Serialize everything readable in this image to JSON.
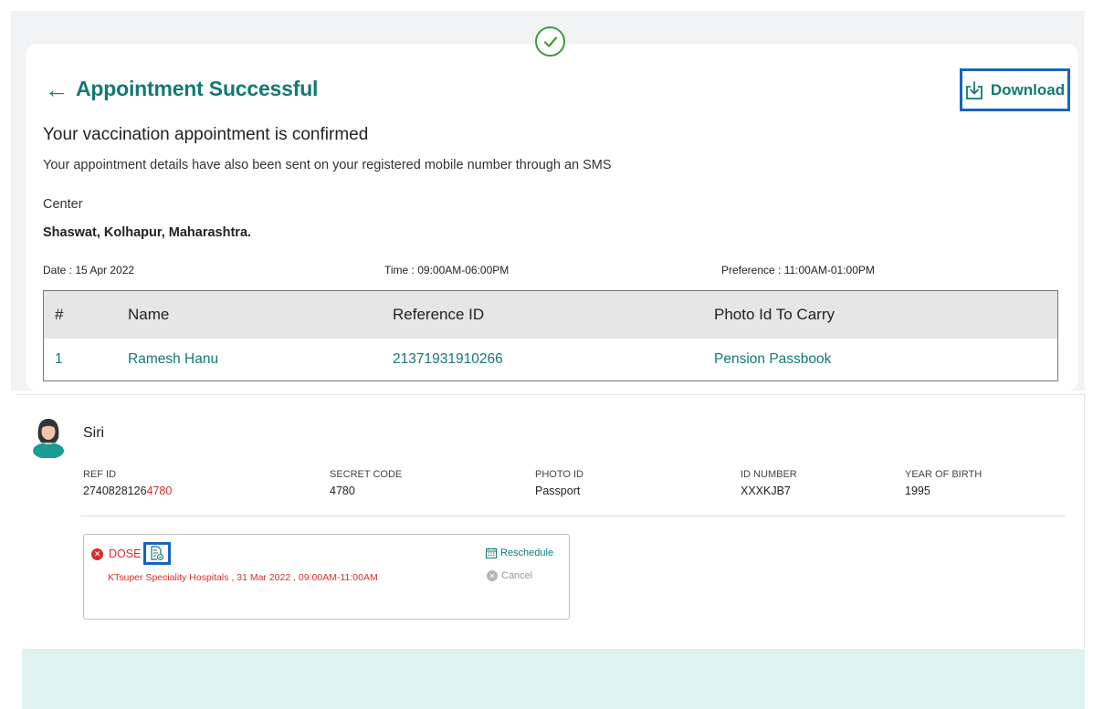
{
  "appointment": {
    "title": "Appointment Successful",
    "download_label": "Download",
    "confirm_heading": "Your vaccination appointment is confirmed",
    "confirm_sub": "Your appointment details have also been sent on your registered mobile number through an SMS",
    "center_label": "Center",
    "center_name": "Shaswat, Kolhapur, Maharashtra.",
    "date_text": "Date : 15 Apr 2022",
    "time_text": "Time : 09:00AM-06:00PM",
    "preference_text": "Preference : 11:00AM-01:00PM",
    "table": {
      "headers": [
        "#",
        "Name",
        "Reference ID",
        "Photo Id To Carry"
      ],
      "rows": [
        [
          "1",
          "Ramesh Hanu",
          "21371931910266",
          "Pension Passbook"
        ]
      ]
    }
  },
  "beneficiary": {
    "name": "Siri",
    "fields": [
      {
        "label": "REF ID",
        "value_prefix": "2740828126",
        "value_highlight": "4780"
      },
      {
        "label": "SECRET CODE",
        "value": "4780"
      },
      {
        "label": "PHOTO ID",
        "value": "Passport"
      },
      {
        "label": "ID NUMBER",
        "value": "XXXKJB7"
      },
      {
        "label": "YEAR OF BIRTH",
        "value": "1995"
      }
    ],
    "dose": {
      "label": "DOSE 1",
      "detail": "KTsuper Speciality Hospitals , 31 Mar 2022 , 09:00AM-11:00AM",
      "reschedule_label": "Reschedule",
      "cancel_label": "Cancel"
    }
  },
  "icons": {
    "back": "arrow-left-icon",
    "download": "download-icon",
    "success": "check-circle-icon",
    "avatar": "avatar-icon",
    "certificate": "certificate-icon",
    "calendar": "calendar-icon",
    "cancel": "cancel-icon"
  },
  "colors": {
    "accent": "#117a73",
    "highlight_border": "#1565c0",
    "error": "#d32f2f",
    "success": "#3c9a3c",
    "bottom_band": "#dff3f0"
  }
}
